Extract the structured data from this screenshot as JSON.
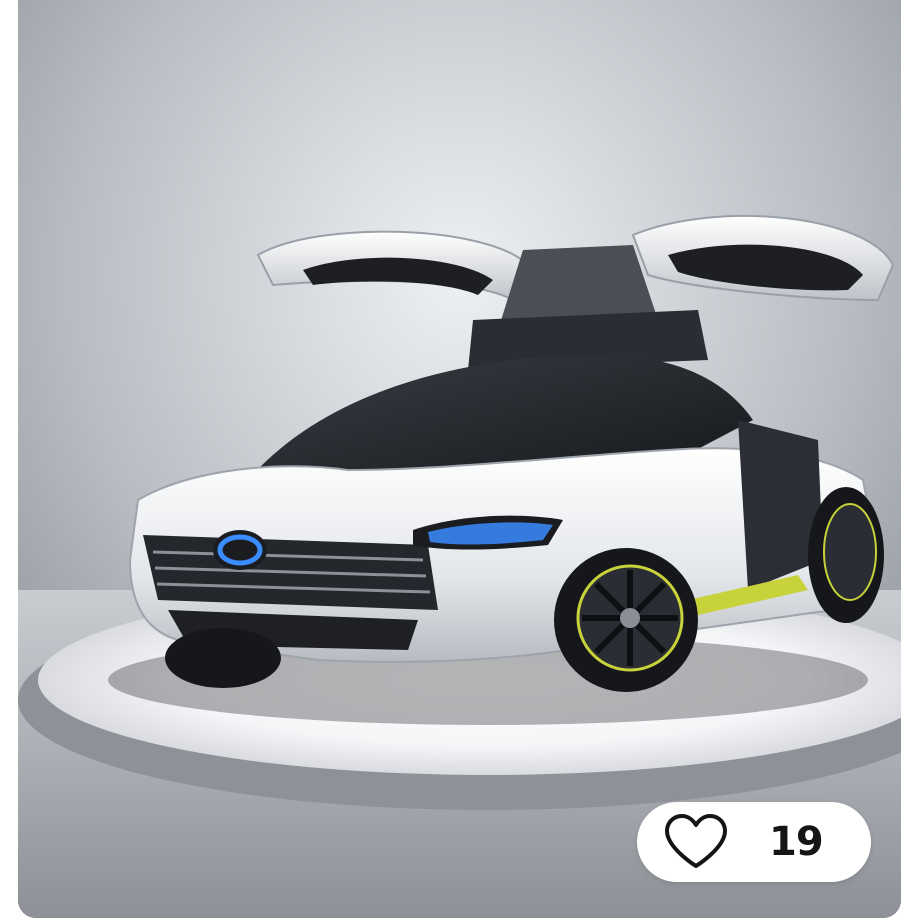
{
  "image": {
    "subject": "car-photo"
  },
  "like": {
    "icon": "heart-outline-icon",
    "count": "19"
  },
  "colors": {
    "pill_background": "#ffffff",
    "count_text": "#151515",
    "backdrop": "#9ea3aa",
    "headlight_accent": "#3a8cff",
    "trim_accent": "#c8d23a"
  }
}
